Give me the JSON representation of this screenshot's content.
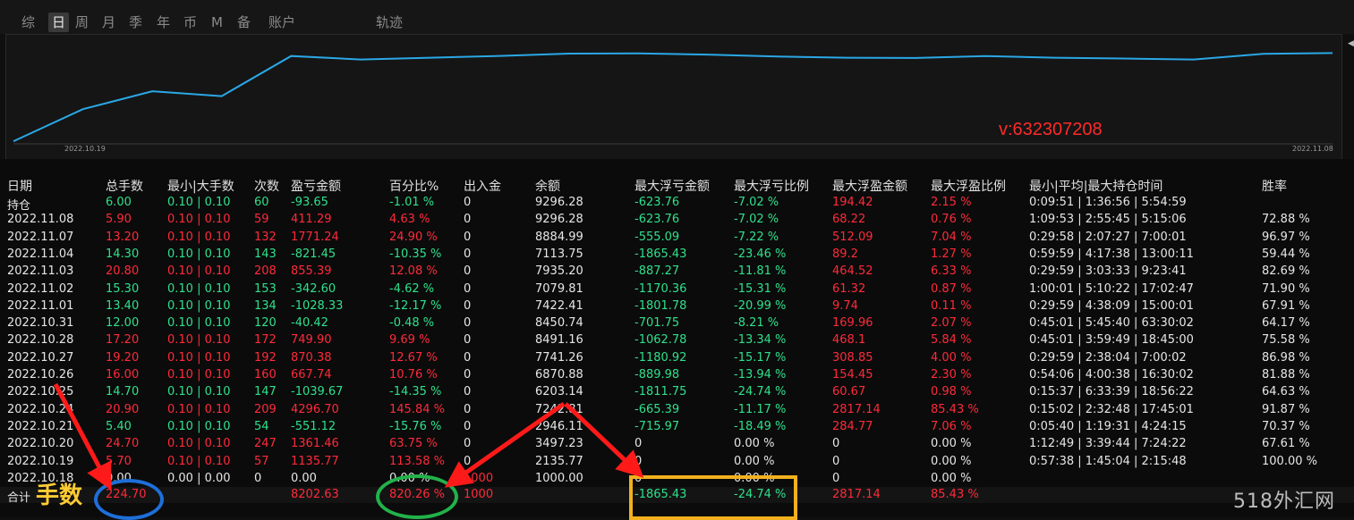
{
  "tabs": [
    "综",
    "日",
    "周",
    "月",
    "季",
    "年",
    "币",
    "M",
    "备",
    "账户",
    "轨迹"
  ],
  "active_tab": "日",
  "equity_curve": {
    "points": [
      6000,
      7240.81,
      7935.2,
      7743.79,
      9296.28,
      9160.0,
      9230.0,
      9300.0,
      9390.0,
      9400.0,
      9350.0,
      9280.0,
      9230.0,
      9220.0,
      9296.28,
      9230.0,
      9200.0,
      9160.0,
      9380.0,
      9410.0
    ],
    "min": 5900,
    "max": 9700,
    "line_color": "#2aa8e6"
  },
  "chart_dates": {
    "start": "2022.10.19",
    "end": "2022.11.08"
  },
  "watermark": "v:632307208",
  "headers": [
    "日期",
    "总手数",
    "最小|大手数",
    "次数",
    "盈亏金额",
    "百分比%",
    "出入金",
    "余额",
    "最大浮亏金额",
    "最大浮亏比例",
    "最大浮盈金额",
    "最大浮盈比例",
    "最小|平均|最大持仓时间",
    "胜率"
  ],
  "rows": [
    {
      "date": "持仓",
      "lots": "6.00",
      "minmax": "0.10 | 0.10",
      "count": "60",
      "pl": "-93.65",
      "pct": "-1.01 %",
      "io": "0",
      "bal": "9296.28",
      "mfa": "-623.76",
      "mfp": "-7.02 %",
      "mpa": "194.42",
      "mpp": "2.15 %",
      "time": "0:09:51 | 1:36:56 | 5:54:59",
      "win": ""
    },
    {
      "date": "2022.11.08",
      "lots": "5.90",
      "minmax": "0.10 | 0.10",
      "count": "59",
      "pl": "411.29",
      "pct": "4.63 %",
      "io": "0",
      "bal": "9296.28",
      "mfa": "-623.76",
      "mfp": "-7.02 %",
      "mpa": "68.22",
      "mpp": "0.76 %",
      "time": "1:09:53 | 2:55:45 | 5:15:06",
      "win": "72.88 %"
    },
    {
      "date": "2022.11.07",
      "lots": "13.20",
      "minmax": "0.10 | 0.10",
      "count": "132",
      "pl": "1771.24",
      "pct": "24.90 %",
      "io": "0",
      "bal": "8884.99",
      "mfa": "-555.09",
      "mfp": "-7.22 %",
      "mpa": "512.09",
      "mpp": "7.04 %",
      "time": "0:29:58 | 2:07:27 | 7:00:01",
      "win": "96.97 %"
    },
    {
      "date": "2022.11.04",
      "lots": "14.30",
      "minmax": "0.10 | 0.10",
      "count": "143",
      "pl": "-821.45",
      "pct": "-10.35 %",
      "io": "0",
      "bal": "7113.75",
      "mfa": "-1865.43",
      "mfp": "-23.46 %",
      "mpa": "89.2",
      "mpp": "1.27 %",
      "time": "0:59:59 | 4:17:38 | 13:00:11",
      "win": "59.44 %"
    },
    {
      "date": "2022.11.03",
      "lots": "20.80",
      "minmax": "0.10 | 0.10",
      "count": "208",
      "pl": "855.39",
      "pct": "12.08 %",
      "io": "0",
      "bal": "7935.20",
      "mfa": "-887.27",
      "mfp": "-11.81 %",
      "mpa": "464.52",
      "mpp": "6.33 %",
      "time": "0:29:59 | 3:03:33 | 9:23:41",
      "win": "82.69 %"
    },
    {
      "date": "2022.11.02",
      "lots": "15.30",
      "minmax": "0.10 | 0.10",
      "count": "153",
      "pl": "-342.60",
      "pct": "-4.62 %",
      "io": "0",
      "bal": "7079.81",
      "mfa": "-1170.36",
      "mfp": "-15.31 %",
      "mpa": "61.32",
      "mpp": "0.87 %",
      "time": "1:00:01 | 5:10:22 | 17:02:47",
      "win": "71.90 %"
    },
    {
      "date": "2022.11.01",
      "lots": "13.40",
      "minmax": "0.10 | 0.10",
      "count": "134",
      "pl": "-1028.33",
      "pct": "-12.17 %",
      "io": "0",
      "bal": "7422.41",
      "mfa": "-1801.78",
      "mfp": "-20.99 %",
      "mpa": "9.74",
      "mpp": "0.11 %",
      "time": "0:29:59 | 4:38:09 | 15:00:01",
      "win": "67.91 %"
    },
    {
      "date": "2022.10.31",
      "lots": "12.00",
      "minmax": "0.10 | 0.10",
      "count": "120",
      "pl": "-40.42",
      "pct": "-0.48 %",
      "io": "0",
      "bal": "8450.74",
      "mfa": "-701.75",
      "mfp": "-8.21 %",
      "mpa": "169.96",
      "mpp": "2.07 %",
      "time": "0:45:01 | 5:45:40 | 63:30:02",
      "win": "64.17 %"
    },
    {
      "date": "2022.10.28",
      "lots": "17.20",
      "minmax": "0.10 | 0.10",
      "count": "172",
      "pl": "749.90",
      "pct": "9.69 %",
      "io": "0",
      "bal": "8491.16",
      "mfa": "-1062.78",
      "mfp": "-13.34 %",
      "mpa": "468.1",
      "mpp": "5.84 %",
      "time": "0:45:01 | 3:59:49 | 18:45:00",
      "win": "75.58 %"
    },
    {
      "date": "2022.10.27",
      "lots": "19.20",
      "minmax": "0.10 | 0.10",
      "count": "192",
      "pl": "870.38",
      "pct": "12.67 %",
      "io": "0",
      "bal": "7741.26",
      "mfa": "-1180.92",
      "mfp": "-15.17 %",
      "mpa": "308.85",
      "mpp": "4.00 %",
      "time": "0:29:59 | 2:38:04 | 7:00:02",
      "win": "86.98 %"
    },
    {
      "date": "2022.10.26",
      "lots": "16.00",
      "minmax": "0.10 | 0.10",
      "count": "160",
      "pl": "667.74",
      "pct": "10.76 %",
      "io": "0",
      "bal": "6870.88",
      "mfa": "-889.98",
      "mfp": "-13.94 %",
      "mpa": "154.45",
      "mpp": "2.30 %",
      "time": "0:54:06 | 4:00:38 | 16:30:02",
      "win": "81.88 %"
    },
    {
      "date": "2022.10.25",
      "lots": "14.70",
      "minmax": "0.10 | 0.10",
      "count": "147",
      "pl": "-1039.67",
      "pct": "-14.35 %",
      "io": "0",
      "bal": "6203.14",
      "mfa": "-1811.75",
      "mfp": "-24.74 %",
      "mpa": "60.67",
      "mpp": "0.98 %",
      "time": "0:15:37 | 6:33:39 | 18:56:22",
      "win": "64.63 %"
    },
    {
      "date": "2022.10.24",
      "lots": "20.90",
      "minmax": "0.10 | 0.10",
      "count": "209",
      "pl": "4296.70",
      "pct": "145.84 %",
      "io": "0",
      "bal": "7242.81",
      "mfa": "-665.39",
      "mfp": "-11.17 %",
      "mpa": "2817.14",
      "mpp": "85.43 %",
      "time": "0:15:02 | 2:32:48 | 17:45:01",
      "win": "91.87 %"
    },
    {
      "date": "2022.10.21",
      "lots": "5.40",
      "minmax": "0.10 | 0.10",
      "count": "54",
      "pl": "-551.12",
      "pct": "-15.76 %",
      "io": "0",
      "bal": "2946.11",
      "mfa": "-715.97",
      "mfp": "-18.49 %",
      "mpa": "284.77",
      "mpp": "7.06 %",
      "time": "0:05:40 | 1:19:31 | 4:24:15",
      "win": "70.37 %"
    },
    {
      "date": "2022.10.20",
      "lots": "24.70",
      "minmax": "0.10 | 0.10",
      "count": "247",
      "pl": "1361.46",
      "pct": "63.75 %",
      "io": "0",
      "bal": "3497.23",
      "mfa": "0",
      "mfp": "0.00 %",
      "mpa": "0",
      "mpp": "0.00 %",
      "time": "1:12:49 | 3:39:44 | 7:24:22",
      "win": "67.61 %"
    },
    {
      "date": "2022.10.19",
      "lots": "5.70",
      "minmax": "0.10 | 0.10",
      "count": "57",
      "pl": "1135.77",
      "pct": "113.58 %",
      "io": "0",
      "bal": "2135.77",
      "mfa": "0",
      "mfp": "0.00 %",
      "mpa": "0",
      "mpp": "0.00 %",
      "time": "0:57:38 | 1:45:04 | 2:15:48",
      "win": "100.00 %"
    },
    {
      "date": "2022.10.18",
      "lots": "0.00",
      "minmax": "0.00 | 0.00",
      "count": "0",
      "pl": "0.00",
      "pct": "0.00 %",
      "io": "1000",
      "bal": "1000.00",
      "mfa": "0",
      "mfp": "0.00 %",
      "mpa": "0",
      "mpp": "0.00 %",
      "time": "",
      "win": ""
    }
  ],
  "total": {
    "label": "合计",
    "lots": "224.70",
    "pl": "8202.63",
    "pct": "820.26 %",
    "io": "1000",
    "mfa": "-1865.43",
    "mfp": "-24.74 %",
    "mpa": "2817.14",
    "mpp": "85.43 %"
  },
  "annotation": "手数",
  "site_logo": "518外汇网",
  "colors": {
    "profit": "#ff2a3a",
    "loss": "#2fe08c",
    "neutral": "#e6e6e6"
  }
}
